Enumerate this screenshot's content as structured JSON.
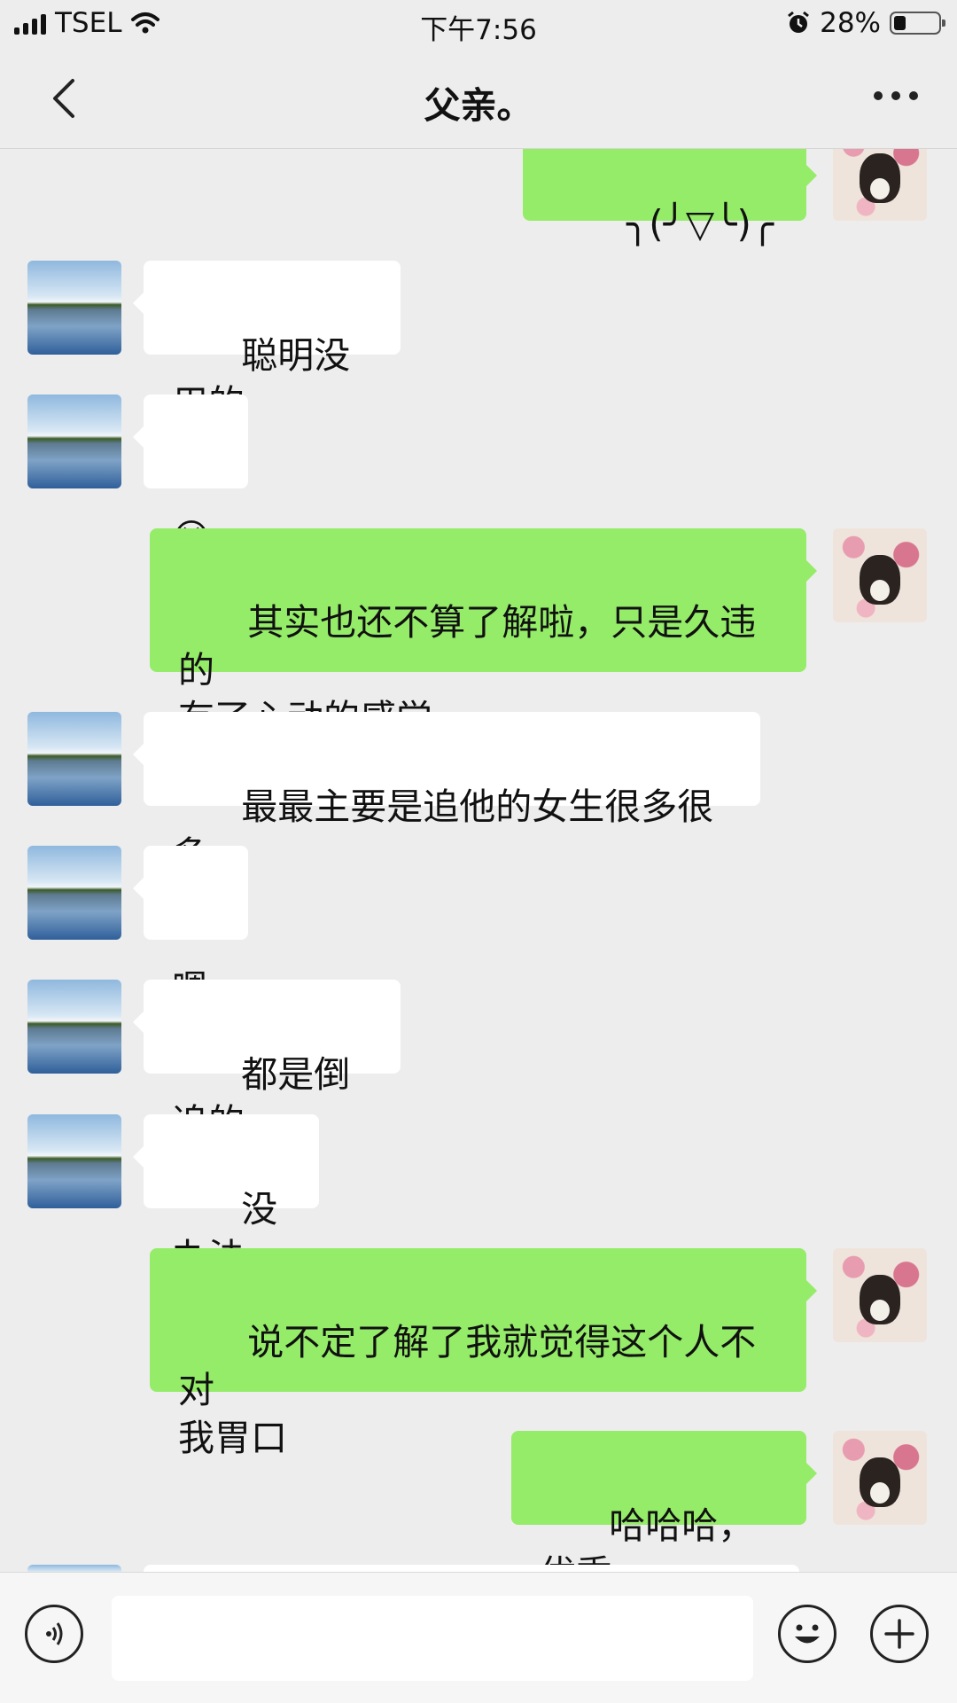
{
  "status_bar": {
    "carrier": "TSEL",
    "time": "下午7:56",
    "battery_percent": "28%",
    "battery_level": 0.28,
    "icons": [
      "signal-icon",
      "wifi-icon",
      "alarm-icon",
      "battery-icon"
    ]
  },
  "header": {
    "title": "父亲。",
    "back_icon": "chevron-left-icon",
    "more_icon": "more-dots-icon"
  },
  "messages": [
    {
      "side": "out",
      "text": "╮(╯▽╰)╭"
    },
    {
      "side": "in",
      "text": "聪明没用的"
    },
    {
      "side": "in",
      "text": "😭"
    },
    {
      "side": "out",
      "text": "其实也还不算了解啦，只是久违的\n有了心动的感觉"
    },
    {
      "side": "in",
      "text": "最最主要是追他的女生很多很多"
    },
    {
      "side": "in",
      "text": "嗯"
    },
    {
      "side": "in",
      "text": "都是倒追的"
    },
    {
      "side": "in",
      "text": "没办法"
    },
    {
      "side": "out",
      "text": "说不定了解了我就觉得这个人不对\n我胃口"
    },
    {
      "side": "out",
      "text": "哈哈哈，优秀"
    }
  ],
  "input_bar": {
    "text_value": "",
    "voice_icon": "voice-icon",
    "emoji_icon": "emoji-icon",
    "plus_icon": "plus-icon"
  },
  "colors": {
    "background": "#ededed",
    "outgoing_bubble": "#95ec69",
    "incoming_bubble": "#ffffff"
  }
}
